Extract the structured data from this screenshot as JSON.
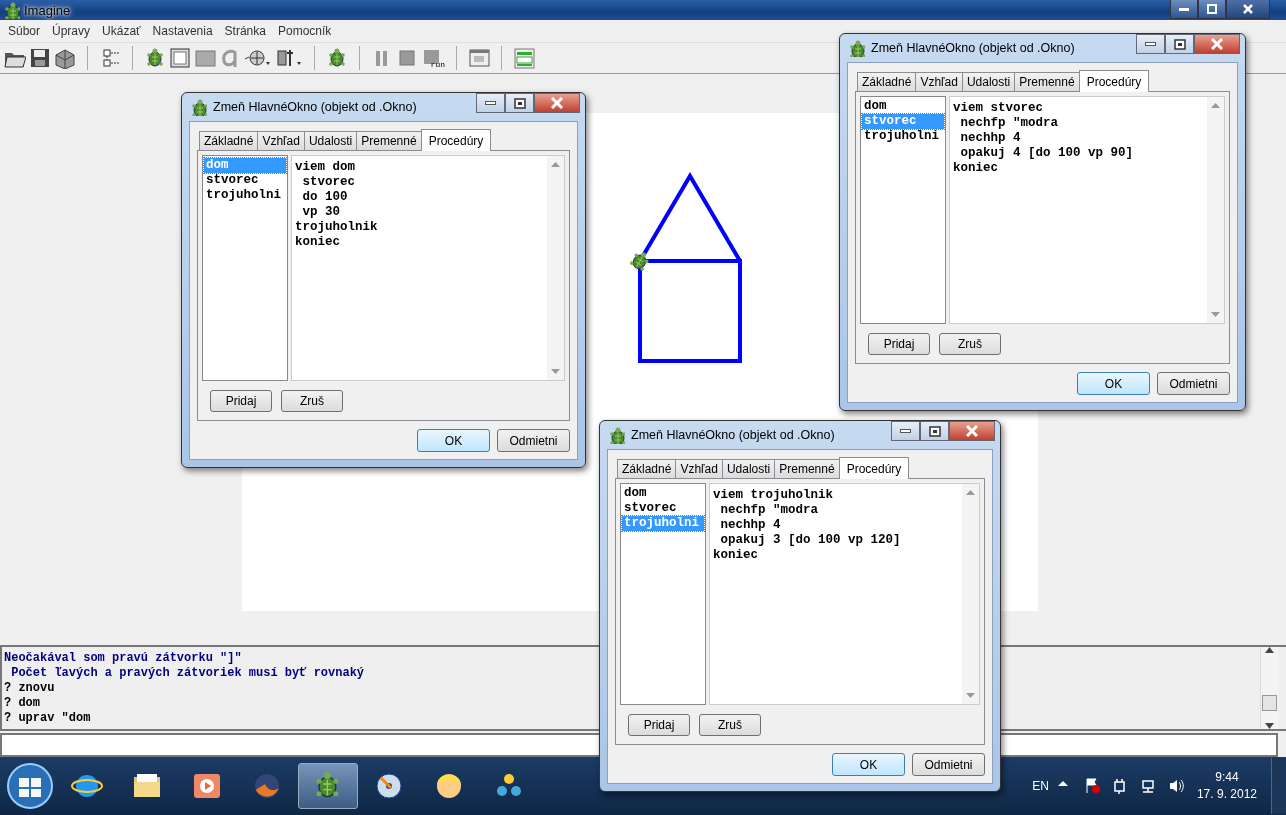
{
  "window": {
    "title": "Imagine"
  },
  "menu": [
    "Súbor",
    "Úpravy",
    "Ukázať",
    "Nastavenia",
    "Stránka",
    "Pomocník"
  ],
  "toolbar": {
    "run_label": "run"
  },
  "dialogs": [
    {
      "title": "Zmeň HlavnéOkno (objekt od .Okno)",
      "tabs": [
        {
          "label": "Základné",
          "selected": false
        },
        {
          "label": "Vzhľad",
          "selected": false
        },
        {
          "label": "Udalosti",
          "selected": false
        },
        {
          "label": "Premenné",
          "selected": false
        },
        {
          "label": "Procedúry",
          "selected": true
        }
      ],
      "procedures": [
        {
          "name": "dom",
          "selected": true
        },
        {
          "name": "stvorec",
          "selected": false
        },
        {
          "name": "trojuholni",
          "selected": false
        }
      ],
      "code": [
        "viem dom",
        " stvorec",
        " do 100",
        " vp 30",
        "trojuholnik",
        "koniec"
      ],
      "list_buttons": [
        "Pridaj",
        "Zruš"
      ],
      "buttons": [
        {
          "label": "OK",
          "default": true
        },
        {
          "label": "Odmietni",
          "default": false
        }
      ]
    },
    {
      "title": "Zmeň HlavnéOkno (objekt od .Okno)",
      "tabs": [
        {
          "label": "Základné",
          "selected": false
        },
        {
          "label": "Vzhľad",
          "selected": false
        },
        {
          "label": "Udalosti",
          "selected": false
        },
        {
          "label": "Premenné",
          "selected": false
        },
        {
          "label": "Procedúry",
          "selected": true
        }
      ],
      "procedures": [
        {
          "name": "dom",
          "selected": false
        },
        {
          "name": "stvorec",
          "selected": true
        },
        {
          "name": "trojuholni",
          "selected": false
        }
      ],
      "code": [
        "viem stvorec",
        " nechfp \"modra",
        " nechhp 4",
        " opakuj 4 [do 100 vp 90]",
        "koniec"
      ],
      "list_buttons": [
        "Pridaj",
        "Zruš"
      ],
      "buttons": [
        {
          "label": "OK",
          "default": true
        },
        {
          "label": "Odmietni",
          "default": false
        }
      ]
    },
    {
      "title": "Zmeň HlavnéOkno (objekt od .Okno)",
      "tabs": [
        {
          "label": "Základné",
          "selected": false
        },
        {
          "label": "Vzhľad",
          "selected": false
        },
        {
          "label": "Udalosti",
          "selected": false
        },
        {
          "label": "Premenné",
          "selected": false
        },
        {
          "label": "Procedúry",
          "selected": true
        }
      ],
      "procedures": [
        {
          "name": "dom",
          "selected": false
        },
        {
          "name": "stvorec",
          "selected": false
        },
        {
          "name": "trojuholni",
          "selected": true
        }
      ],
      "code": [
        "viem trojuholnik",
        " nechfp \"modra",
        " nechhp 4",
        " opakuj 3 [do 100 vp 120]",
        "koniec"
      ],
      "list_buttons": [
        "Pridaj",
        "Zruš"
      ],
      "buttons": [
        {
          "label": "OK",
          "default": true
        },
        {
          "label": "Odmietni",
          "default": false
        }
      ]
    }
  ],
  "console": {
    "lines": [
      {
        "text": "Neočakával som pravú zátvorku \"]\"",
        "kind": "message"
      },
      {
        "text": " Počet ľavých a pravých zátvoriek musí byť rovnaký",
        "kind": "message"
      },
      {
        "text": "? znovu",
        "kind": "command"
      },
      {
        "text": "? dom",
        "kind": "command"
      },
      {
        "text": "? uprav \"dom",
        "kind": "command"
      }
    ]
  },
  "taskbar": {
    "apps": [
      {
        "selected": false
      },
      {
        "selected": false
      },
      {
        "selected": false
      },
      {
        "selected": false
      },
      {
        "selected": true
      },
      {
        "selected": false
      },
      {
        "selected": false
      },
      {
        "selected": false
      }
    ],
    "language": "EN",
    "time": "9:44",
    "date": "17. 9. 2012"
  }
}
